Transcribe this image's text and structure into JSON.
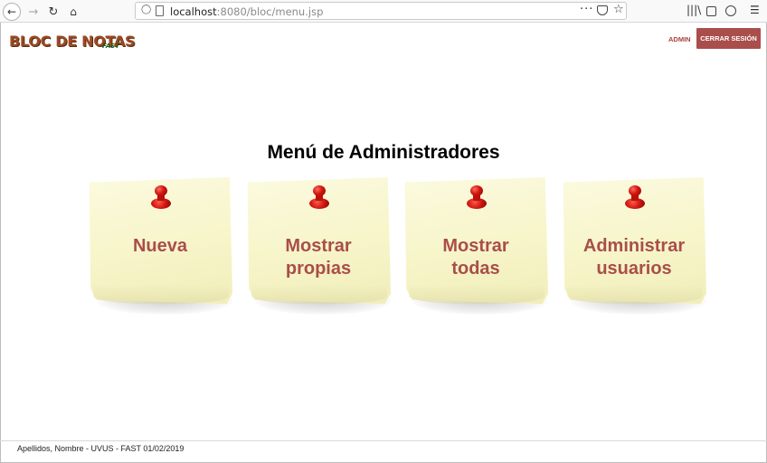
{
  "browser": {
    "url_host": "localhost",
    "url_rest": ":8080/bloc/menu.jsp",
    "icons": [
      "back-arrow-icon",
      "forward-arrow-icon",
      "reload-icon",
      "home-icon",
      "shield-icon",
      "page-icon",
      "more-dots-icon",
      "pocket-icon",
      "bookmark-star-icon",
      "library-icon",
      "sidebar-icon",
      "account-icon",
      "hamburger-menu-icon"
    ]
  },
  "header": {
    "logo_main": "BLOC DE NOTAS",
    "logo_sub": "FAST",
    "admin_label": "ADMIN",
    "logout_label": "CERRAR SESIÓN"
  },
  "main": {
    "title": "Menú de Administradores",
    "notes": [
      {
        "label_line1": "Nueva",
        "label_line2": ""
      },
      {
        "label_line1": "Mostrar",
        "label_line2": "propias"
      },
      {
        "label_line1": "Mostrar",
        "label_line2": "todas"
      },
      {
        "label_line1": "Administrar",
        "label_line2": "usuarios"
      }
    ]
  },
  "footer": {
    "text": "Apellidos, Nombre - UVUS - FAST 01/02/2019"
  },
  "colors": {
    "accent": "#a94e4b",
    "note_paper": "#f7f5c9",
    "logo_brown": "#9a4a24",
    "logo_green": "#1a5c12"
  }
}
